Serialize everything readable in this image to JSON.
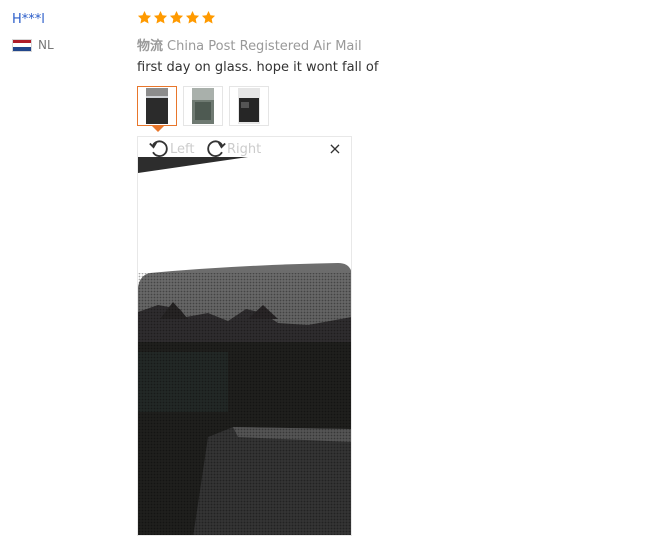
{
  "reviewer": {
    "name": "H***l",
    "country_code": "NL",
    "flag_colors": [
      "#ae1c28",
      "#ffffff",
      "#21468b"
    ]
  },
  "rating": {
    "value": 5,
    "max": 5,
    "color": "#ff9a00"
  },
  "logistics": {
    "label": "物流",
    "value": "China Post Registered Air Mail"
  },
  "review_text": "first day on glass. hope it wont fall of",
  "thumbnails": [
    {
      "name": "thumb-1",
      "active": true
    },
    {
      "name": "thumb-2",
      "active": false
    },
    {
      "name": "thumb-3",
      "active": false
    }
  ],
  "viewer": {
    "rotate_left_label": "Left",
    "rotate_right_label": "Right",
    "close_symbol": "×",
    "icons": {
      "rotate_left": "rotate-left-icon",
      "rotate_right": "rotate-right-icon",
      "close": "close-icon"
    }
  },
  "colors": {
    "link": "#2a5cc9",
    "accent": "#e8762b",
    "muted": "#999999"
  }
}
